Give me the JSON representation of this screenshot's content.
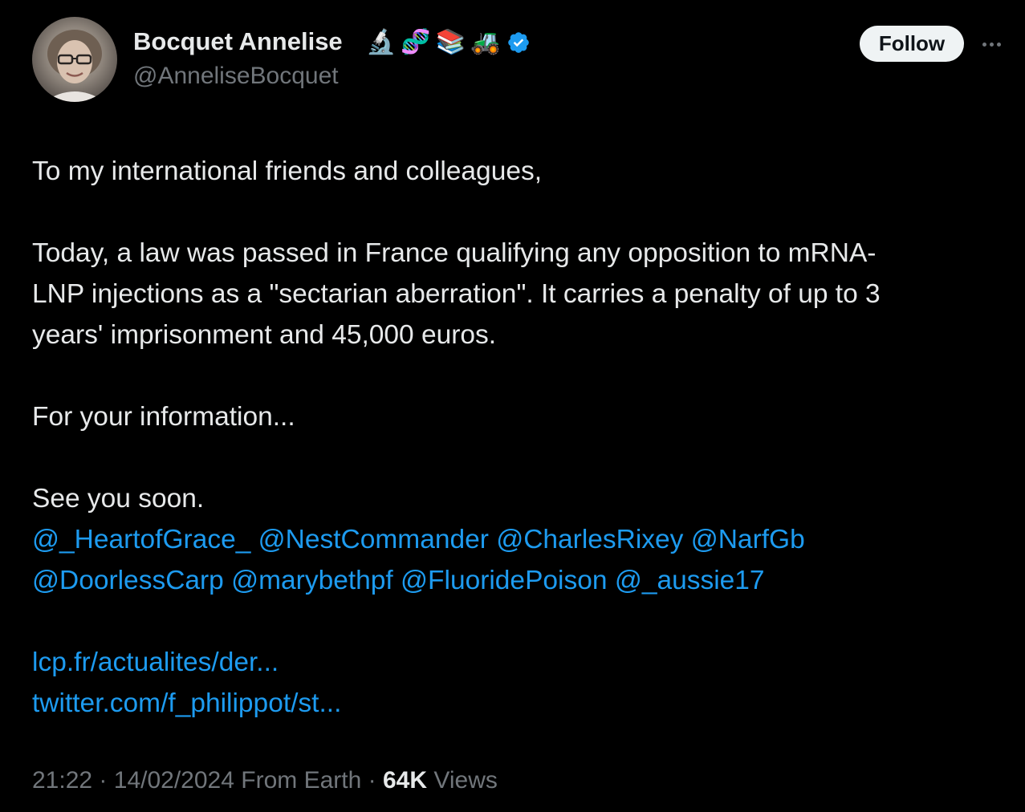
{
  "author": {
    "display_name": "Bocquet Annelise",
    "handle": "@AnneliseBocquet",
    "name_emojis": [
      "🔬",
      "🧬",
      "📚",
      "🚜"
    ],
    "verified": true
  },
  "actions": {
    "follow_label": "Follow",
    "more_icon": "more-horizontal-icon"
  },
  "tweet": {
    "p1": "To my international friends and colleagues,",
    "p2_line1": "Today, a law was passed in France qualifying any opposition to mRNA-",
    "p2_line2": "LNP injections as a \"sectarian aberration\". It carries a penalty of up to 3",
    "p2_line3": "years' imprisonment and 45,000 euros.",
    "p3": "For your information...",
    "p4": "See you soon.",
    "mentions_line1": [
      "@_HeartofGrace_",
      "@NestCommander",
      "@CharlesRixey",
      "@NarfGb"
    ],
    "mentions_line2": [
      "@DoorlessCarp",
      "@marybethpf",
      "@FluoridePoison",
      "@_aussie17"
    ],
    "links": [
      "lcp.fr/actualites/der...",
      "twitter.com/f_philippot/st..."
    ]
  },
  "meta": {
    "time": "21:22",
    "date": "14/02/2024",
    "source": "From Earth",
    "separator": "·",
    "views_count": "64K",
    "views_label": "Views"
  },
  "colors": {
    "background": "#000000",
    "text": "#e7e9ea",
    "secondary": "#71767b",
    "accent": "#1d9bf0",
    "follow_bg": "#eff3f4"
  }
}
